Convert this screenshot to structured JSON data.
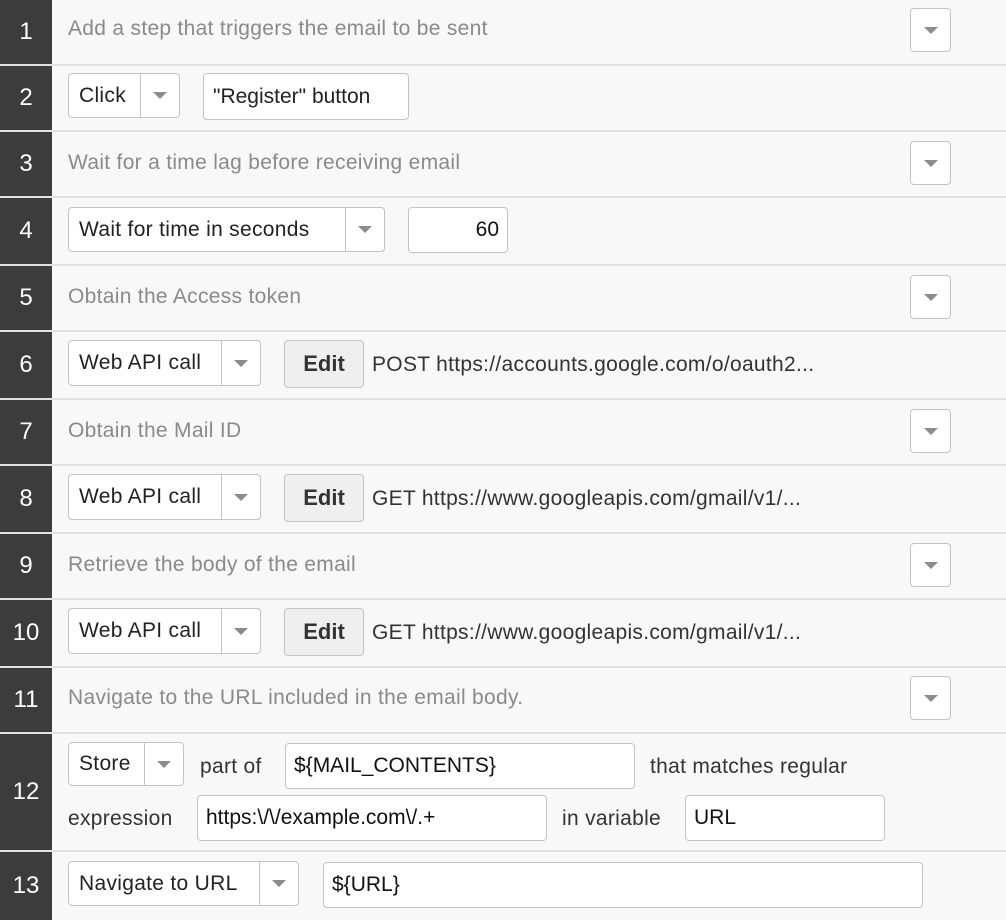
{
  "steps": [
    {
      "num": "1",
      "comment": "Add a step that triggers the email to be sent"
    },
    {
      "num": "2",
      "action": "Click",
      "target": "\"Register\" button"
    },
    {
      "num": "3",
      "comment": "Wait for a time lag before receiving email"
    },
    {
      "num": "4",
      "action": "Wait for time in seconds",
      "value": "60"
    },
    {
      "num": "5",
      "comment": "Obtain the Access token"
    },
    {
      "num": "6",
      "action": "Web API call",
      "edit": "Edit",
      "request": "POST https://accounts.google.com/o/oauth2..."
    },
    {
      "num": "7",
      "comment": "Obtain the Mail ID"
    },
    {
      "num": "8",
      "action": "Web API call",
      "edit": "Edit",
      "request": "GET https://www.googleapis.com/gmail/v1/..."
    },
    {
      "num": "9",
      "comment": "Retrieve the body of the email"
    },
    {
      "num": "10",
      "action": "Web API call",
      "edit": "Edit",
      "request": "GET https://www.googleapis.com/gmail/v1/..."
    },
    {
      "num": "11",
      "comment": "Navigate to the URL included in the email body."
    },
    {
      "num": "12",
      "action": "Store",
      "part_of_label": "part of",
      "source": "${MAIL_CONTENTS}",
      "matches_label": "that matches regular",
      "expression_label": "expression",
      "regex": "https:\\/\\/example.com\\/.+",
      "in_variable_label": "in variable",
      "variable": "URL"
    },
    {
      "num": "13",
      "action": "Navigate to URL",
      "url": "${URL}"
    }
  ],
  "icons": {
    "dropdown": "chevron-down-icon"
  }
}
